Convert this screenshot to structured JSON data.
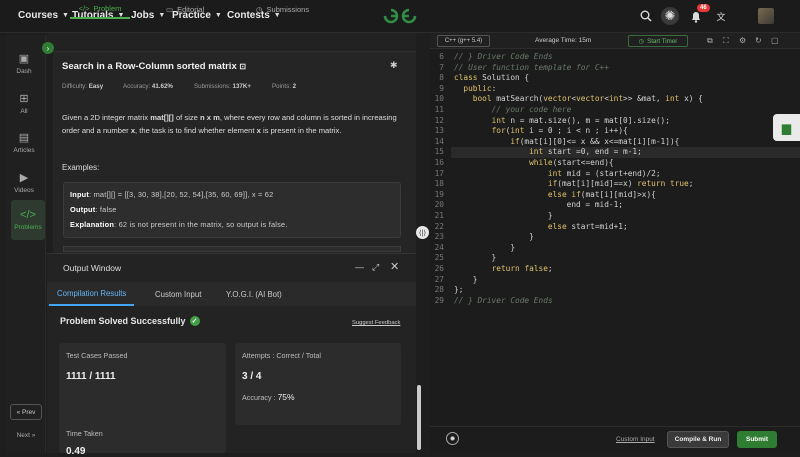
{
  "nav": {
    "items": [
      "Courses",
      "Tutorials",
      "Jobs",
      "Practice",
      "Contests"
    ],
    "notification_count": "46"
  },
  "sidebar": {
    "items": [
      {
        "label": "Dash",
        "icon": "dashboard-icon"
      },
      {
        "label": "All",
        "icon": "grid-icon"
      },
      {
        "label": "Articles",
        "icon": "article-icon"
      },
      {
        "label": "Videos",
        "icon": "video-icon"
      },
      {
        "label": "Problems",
        "icon": "code-icon"
      }
    ],
    "prev": "« Prev",
    "next": "Next »"
  },
  "problem": {
    "tabs": [
      "Problem",
      "Editorial",
      "Submissions"
    ],
    "title": "Search in a Row-Column sorted matrix",
    "difficulty_label": "Difficulty:",
    "difficulty": "Easy",
    "accuracy_label": "Accuracy:",
    "accuracy": "41.62%",
    "submissions_label": "Submissions:",
    "submissions": "137K+",
    "points_label": "Points:",
    "points": "2",
    "desc": {
      "p1": "Given a 2D integer matrix ",
      "b1": "mat[][]",
      "p2": " of size ",
      "b2": "n x m",
      "p3": ", where every row and column is sorted in increasing order and a number ",
      "b3": "x",
      "p4": ", the task is to find whether element ",
      "b4": "x",
      "p5": " is present in the matrix."
    },
    "examples_heading": "Examples:",
    "example": {
      "input_label": "Input",
      "input": ": mat[][] = [[3, 30, 38],[20, 52, 54],[35, 60, 69]], x = 62",
      "output_label": "Output",
      "output": ": false",
      "explanation_label": "Explanation",
      "explanation": ": 62 is not present in the matrix, so output is false."
    }
  },
  "output": {
    "title": "Output Window",
    "tabs": [
      "Compilation Results",
      "Custom Input",
      "Y.O.G.I. (AI Bot)"
    ],
    "status": "Problem Solved Successfully",
    "suggest": "Suggest Feedback",
    "tests_label": "Test Cases Passed",
    "tests_value": "1111 / 1111",
    "attempts_label": "Attempts : Correct / Total",
    "attempts_value": "3 / 4",
    "accuracy_label": "Accuracy :",
    "accuracy_value": "75%",
    "time_label": "Time Taken",
    "time_value": "0.49"
  },
  "editor": {
    "language": "C++ (g++ 5.4)",
    "avg_time": "Average Time: 15m",
    "timer": "Start Timer",
    "line_numbers": [
      "6",
      "7",
      "8",
      "9",
      "10",
      "11",
      "12",
      "13",
      "14",
      "15",
      "16",
      "17",
      "18",
      "19",
      "20",
      "21",
      "22",
      "23",
      "24",
      "25",
      "26",
      "27",
      "28",
      "29"
    ],
    "lines": [
      "// } Driver Code Ends",
      "// User function template for C++",
      "class Solution {",
      "  public:",
      "    bool matSearch(vector<vector<int>> &mat, int x) {",
      "        // your code here",
      "        int n = mat.size(), m = mat[0].size();",
      "        for(int i = 0 ; i < n ; i++){",
      "            if(mat[i][0]<= x && x<=mat[i][m-1]){",
      "                int start =0, end = m-1;",
      "                while(start<=end){",
      "                    int mid = (start+end)/2;",
      "                    if(mat[i][mid]==x) return true;",
      "                    else if(mat[i][mid]>x){",
      "                        end = mid-1;",
      "                    }",
      "                    else start=mid+1;",
      "                }",
      "            }",
      "        }",
      "        return false;",
      "    }",
      "};",
      "// } Driver Code Ends"
    ],
    "custom_input": "Custom Input",
    "compile": "Compile & Run",
    "submit": "Submit"
  }
}
